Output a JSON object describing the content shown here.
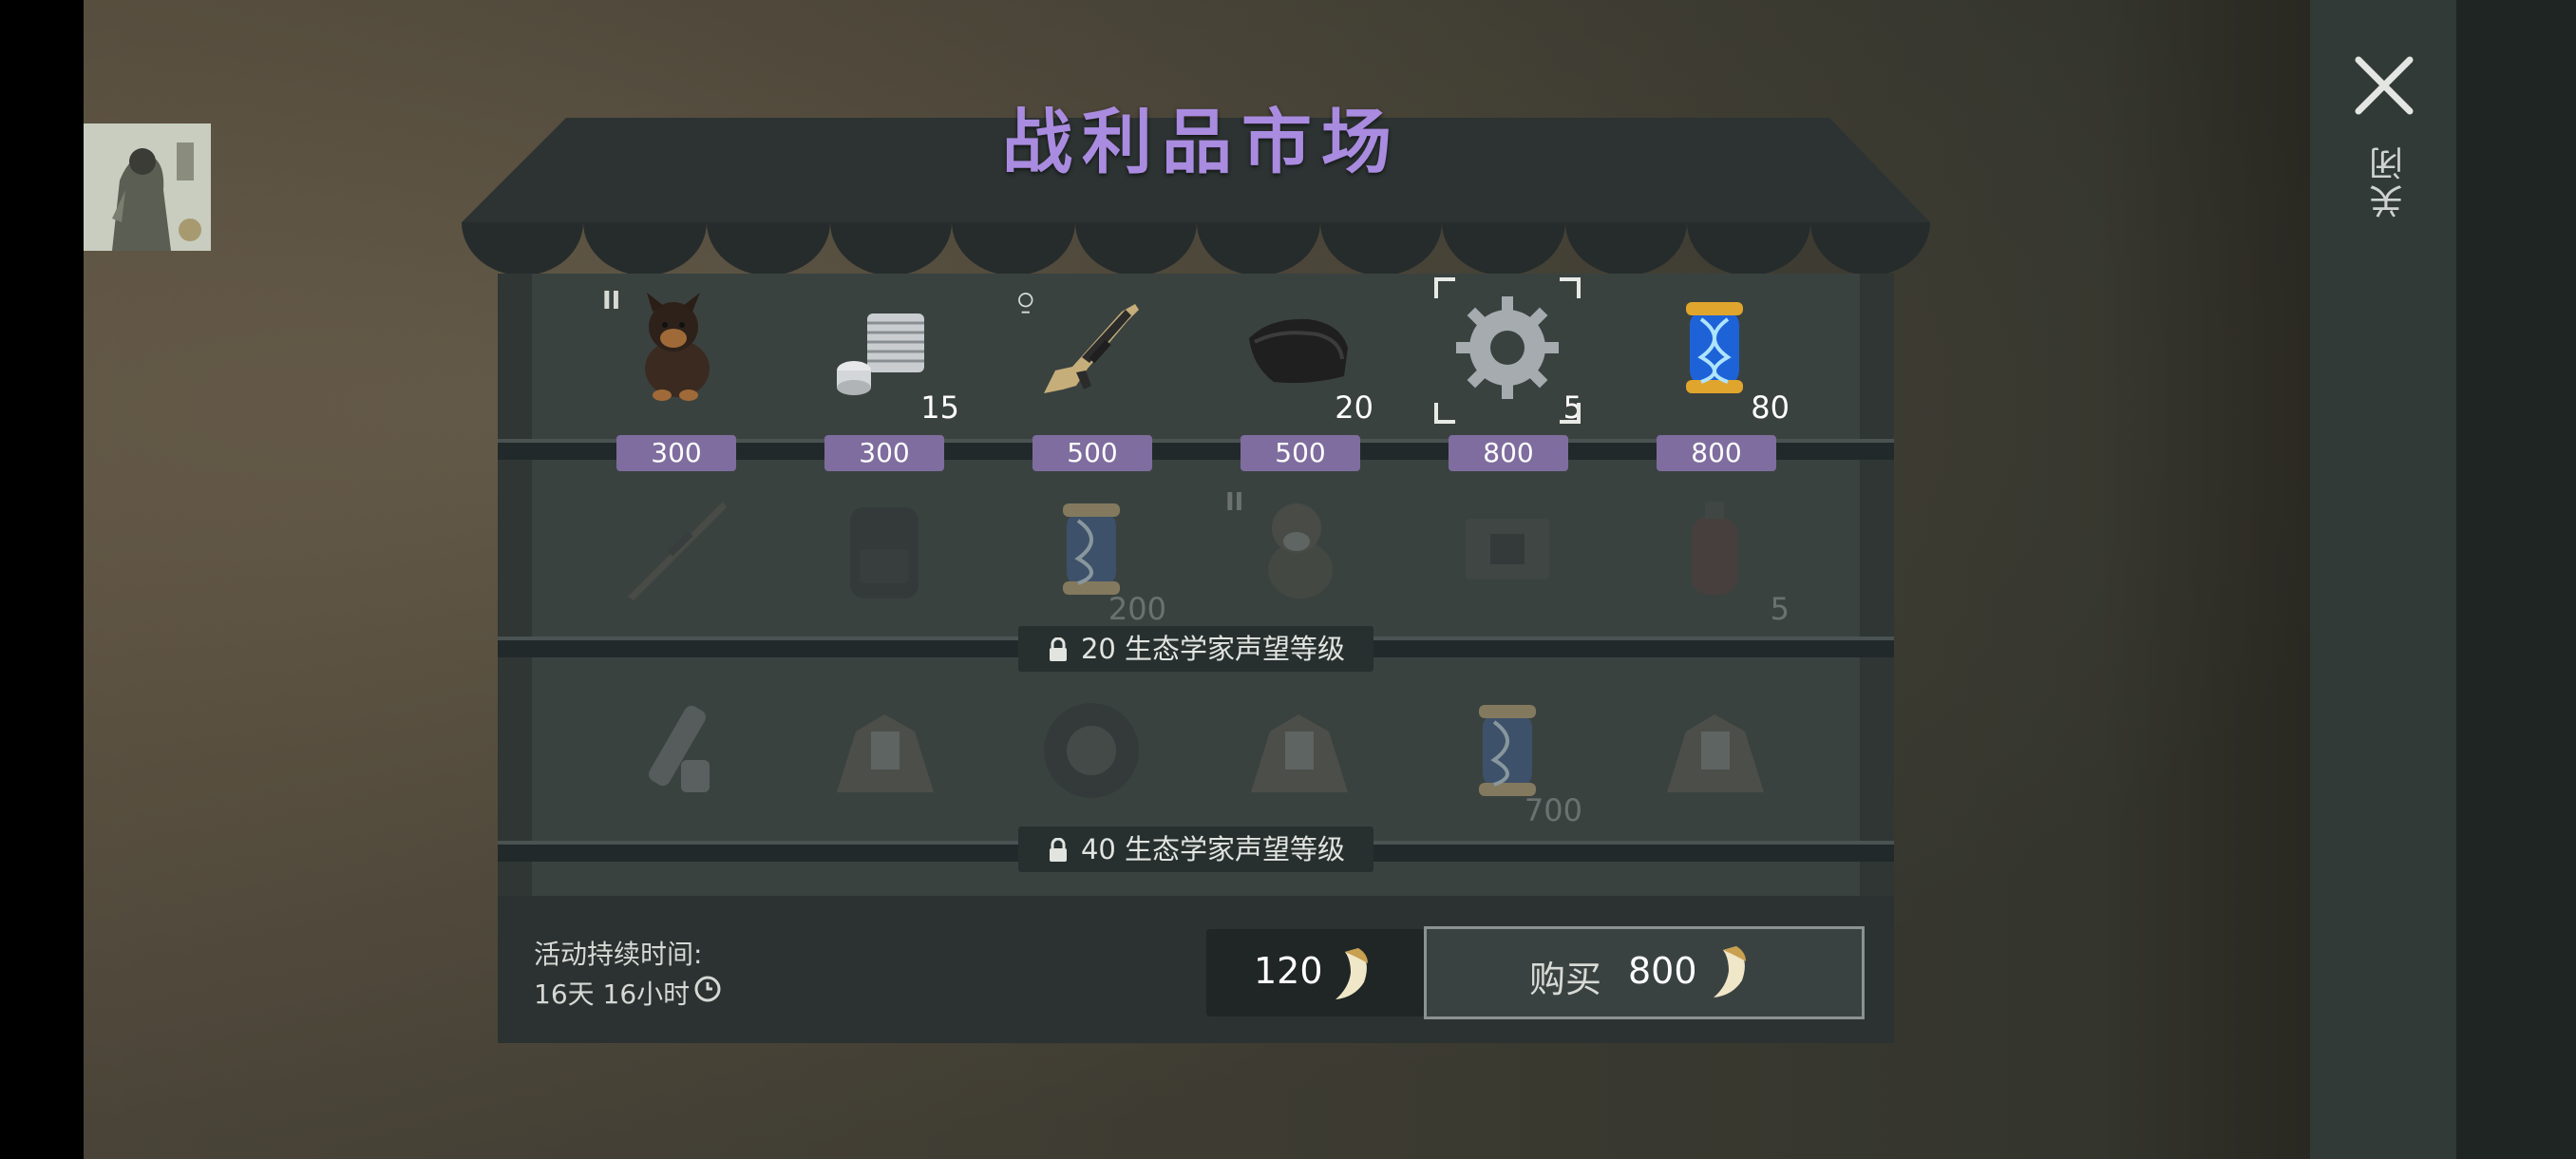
{
  "shop": {
    "title": "战利品市场",
    "row1": [
      {
        "icon": "dog-icon",
        "tier": "II",
        "qty": "",
        "price": "300"
      },
      {
        "icon": "engine-cylinder-icon",
        "tier": "",
        "qty": "15",
        "price": "300"
      },
      {
        "icon": "rifle-icon",
        "tier": "",
        "qty": "",
        "price": "500"
      },
      {
        "icon": "leather-icon",
        "tier": "",
        "qty": "20",
        "price": "500"
      },
      {
        "icon": "gear-icon",
        "tier": "",
        "qty": "5",
        "price": "800"
      },
      {
        "icon": "dna-capsule-icon",
        "tier": "",
        "qty": "80",
        "price": "800"
      }
    ],
    "row2": [
      {
        "icon": "sniper-rifle-icon",
        "tier": "",
        "qty": ""
      },
      {
        "icon": "backpack-icon",
        "tier": "",
        "qty": ""
      },
      {
        "icon": "dna-capsule-icon",
        "tier": "",
        "qty": "200"
      },
      {
        "icon": "dog-icon",
        "tier": "II",
        "qty": ""
      },
      {
        "icon": "circuit-board-icon",
        "tier": "",
        "qty": ""
      },
      {
        "icon": "gas-canister-icon",
        "tier": "",
        "qty": "5"
      }
    ],
    "row3": [
      {
        "icon": "rocket-launcher-icon",
        "tier": "",
        "qty": ""
      },
      {
        "icon": "scrap-pile-icon",
        "tier": "",
        "qty": ""
      },
      {
        "icon": "tire-icon",
        "tier": "",
        "qty": ""
      },
      {
        "icon": "scrap-pile-icon",
        "tier": "",
        "qty": ""
      },
      {
        "icon": "dna-capsule-icon",
        "tier": "",
        "qty": "700"
      },
      {
        "icon": "scrap-pile-icon",
        "tier": "",
        "qty": ""
      }
    ],
    "lock1": "20 生态学家声望等级",
    "lock2": "40 生态学家声望等级"
  },
  "footer": {
    "duration_label": "活动持续时间:",
    "duration_value": "16天 16小时",
    "balance": "120",
    "buy_label": "购买",
    "buy_price": "800"
  },
  "close_label": "关闭",
  "colors": {
    "title": "#a98be0",
    "price_tag": "#7e6d9e"
  }
}
